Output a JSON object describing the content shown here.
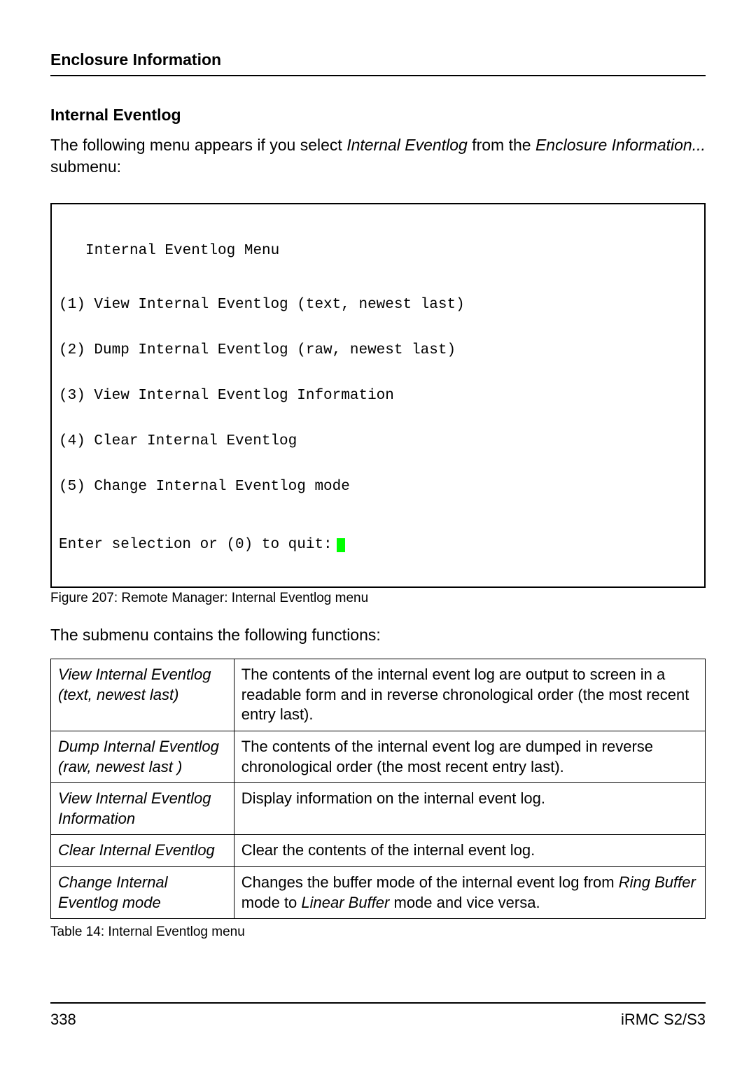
{
  "header": {
    "title": "Enclosure Information"
  },
  "section": {
    "heading": "Internal Eventlog"
  },
  "intro": {
    "prefix": "The following menu appears if you select ",
    "em1": "Internal Eventlog",
    "mid": " from the ",
    "em2": "Enclosure Information...",
    "suffix": " submenu:"
  },
  "terminal": {
    "title": "Internal Eventlog Menu",
    "lines": [
      "(1) View Internal Eventlog (text, newest last)",
      "(2) Dump Internal Eventlog (raw, newest last)",
      "(3) View Internal Eventlog Information",
      "(4) Clear Internal Eventlog",
      "(5) Change Internal Eventlog mode"
    ],
    "prompt": "Enter selection or (0) to quit:"
  },
  "figure_caption": "Figure 207: Remote Manager: Internal Eventlog menu",
  "submenu_intro": "The submenu contains the following functions:",
  "table": {
    "rows": [
      {
        "name": "View Internal Eventlog (text, newest last)",
        "desc": "The contents of the internal event log are output to screen in a readable form and in reverse chronological order (the most recent entry last)."
      },
      {
        "name": "Dump Internal Eventlog (raw, newest last )",
        "desc": "The contents of the internal event log are dumped in reverse chronological order (the most recent entry last)."
      },
      {
        "name": "View Internal Eventlog Information",
        "desc": "Display information on the internal event log."
      },
      {
        "name": "Clear Internal Eventlog",
        "desc": "Clear the contents of the internal event log."
      },
      {
        "name": "Change Internal Eventlog mode",
        "desc_pre": "Changes the buffer mode of the internal event log from ",
        "em1": "Ring Buffer",
        "mid": " mode to ",
        "em2": "Linear Buffer",
        "suffix": " mode and vice versa."
      }
    ]
  },
  "table_caption": "Table 14:  Internal Eventlog menu",
  "footer": {
    "page": "338",
    "doc": "iRMC S2/S3"
  }
}
